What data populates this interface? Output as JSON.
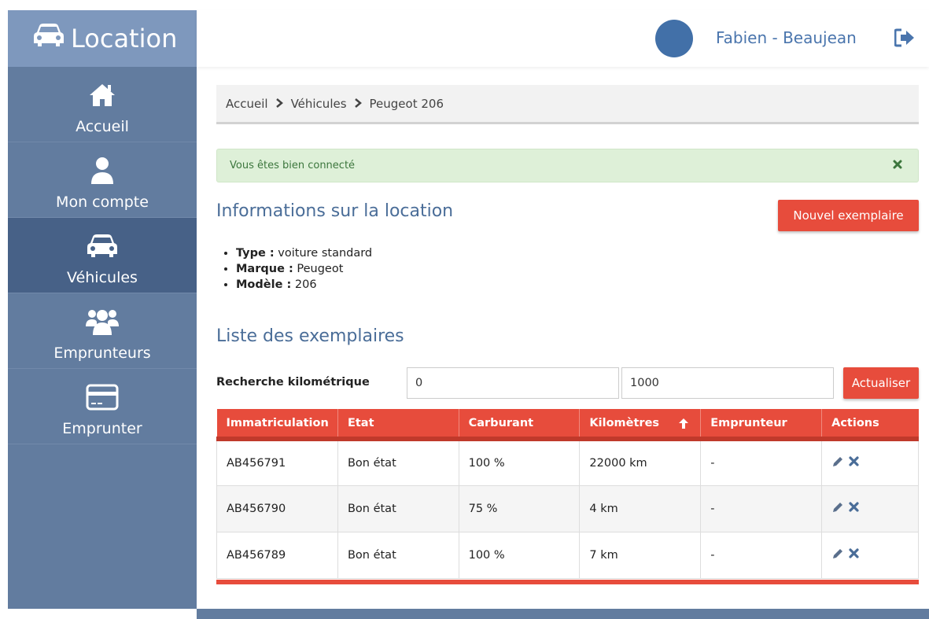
{
  "app": {
    "title": "Location"
  },
  "sidebar": {
    "items": [
      {
        "label": "Accueil",
        "icon": "home-icon"
      },
      {
        "label": "Mon compte",
        "icon": "user-icon"
      },
      {
        "label": "Véhicules",
        "icon": "car-icon"
      },
      {
        "label": "Emprunteurs",
        "icon": "users-icon"
      },
      {
        "label": "Emprunter",
        "icon": "credit-card-icon"
      }
    ],
    "active": "Véhicules"
  },
  "header": {
    "username": "Fabien - Beaujean",
    "logout_icon": "sign-out-icon"
  },
  "breadcrumb": {
    "items": [
      "Accueil",
      "Véhicules",
      "Peugeot 206"
    ]
  },
  "alert": {
    "message": "Vous êtes bien connecté"
  },
  "info": {
    "title": "Informations sur la location",
    "new_button": "Nouvel exemplaire",
    "type_label": "Type :",
    "type_value": "voiture standard",
    "brand_label": "Marque :",
    "brand_value": "Peugeot",
    "model_label": "Modèle :",
    "model_value": "206"
  },
  "list": {
    "title": "Liste des exemplaires",
    "search_label": "Recherche kilométrique",
    "min_value": "0",
    "max_value": "1000",
    "refresh_button": "Actualiser"
  },
  "table": {
    "headers": [
      "Immatriculation",
      "Etat",
      "Carburant",
      "Kilomètres",
      "Emprunteur",
      "Actions"
    ],
    "sort_column": "Kilomètres",
    "rows": [
      [
        "AB456791",
        "Bon état",
        "100 %",
        "22000 km",
        "-"
      ],
      [
        "AB456790",
        "Bon état",
        "75 %",
        "4 km",
        "-"
      ],
      [
        "AB456789",
        "Bon état",
        "100 %",
        "7 km",
        "-"
      ]
    ]
  },
  "colors": {
    "accent": "#e74c3c",
    "sidebar": "#627c9f",
    "sidebar_active": "#476187",
    "brand_bar": "#7e98bd",
    "heading": "#4a6d98",
    "success_bg": "#def0d8"
  }
}
